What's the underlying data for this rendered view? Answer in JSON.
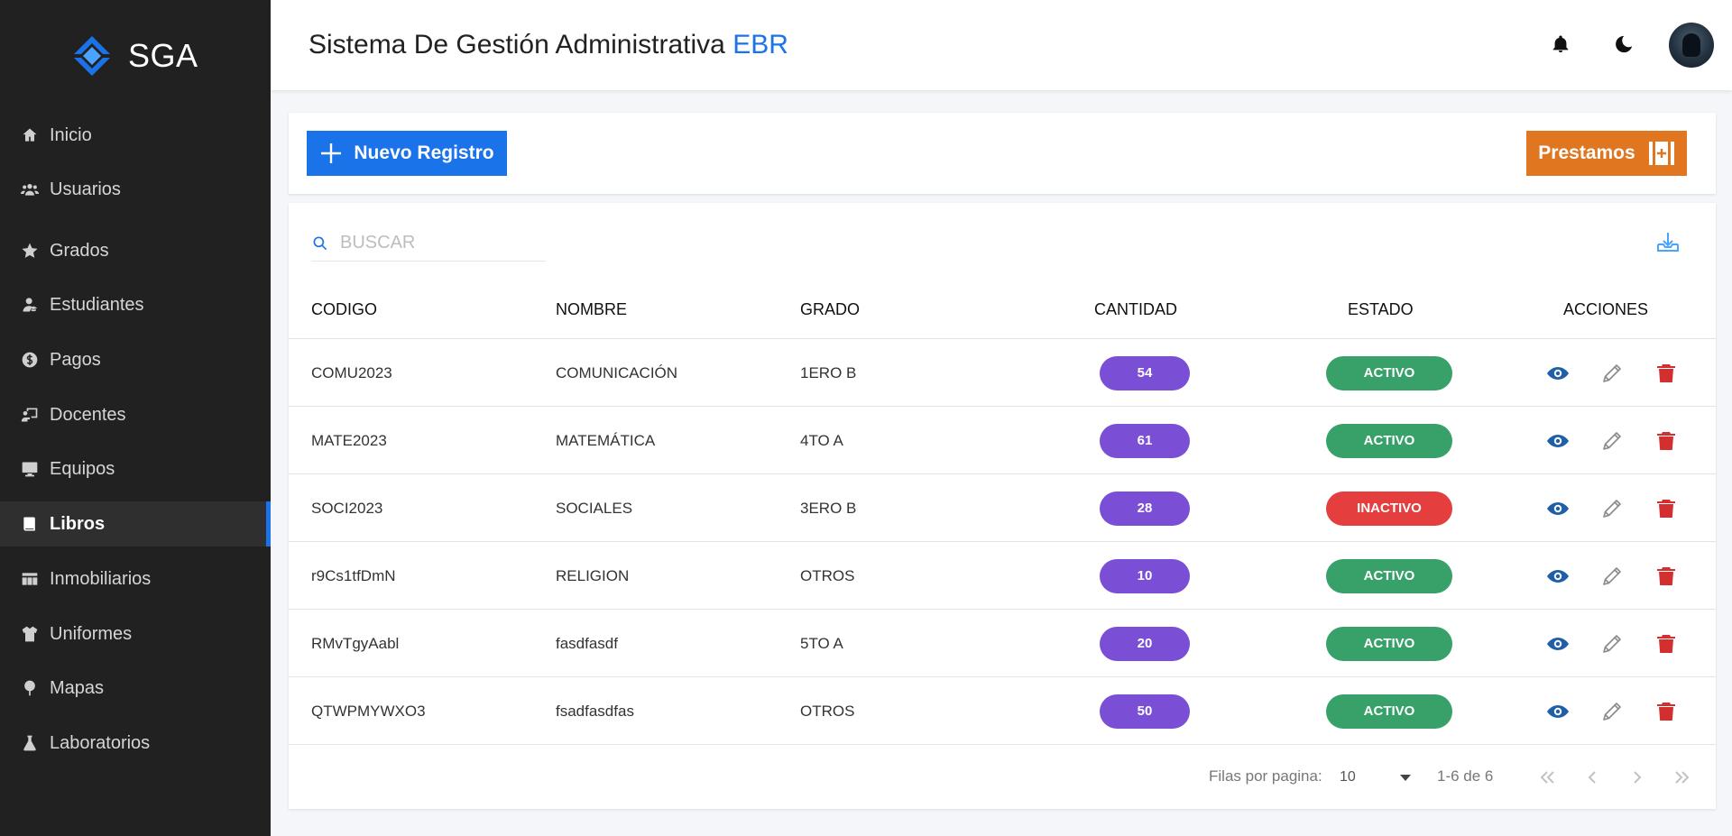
{
  "brand": {
    "name": "SGA",
    "accent": "#1a73e8"
  },
  "sidebar": {
    "items": [
      {
        "label": "Inicio",
        "icon": "home-icon"
      },
      {
        "label": "Usuarios",
        "icon": "users-icon"
      },
      {
        "label": "Grados",
        "icon": "star-icon"
      },
      {
        "label": "Estudiantes",
        "icon": "student-icon"
      },
      {
        "label": "Pagos",
        "icon": "dollar-icon"
      },
      {
        "label": "Docentes",
        "icon": "teacher-icon"
      },
      {
        "label": "Equipos",
        "icon": "monitor-icon"
      },
      {
        "label": "Libros",
        "icon": "book-icon",
        "active": true
      },
      {
        "label": "Inmobiliarios",
        "icon": "table-icon"
      },
      {
        "label": "Uniformes",
        "icon": "uniform-icon"
      },
      {
        "label": "Mapas",
        "icon": "map-pin-icon"
      },
      {
        "label": "Laboratorios",
        "icon": "flask-icon"
      }
    ]
  },
  "header": {
    "title": "Sistema De Gestión Administrativa",
    "title_accent": "EBR",
    "icons": [
      "bell-icon",
      "moon-icon",
      "avatar"
    ]
  },
  "actions": {
    "new_label": "Nuevo Registro",
    "loans_label": "Prestamos",
    "new_color": "#1a73e8",
    "loans_color": "#e07720"
  },
  "search": {
    "placeholder": "BUSCAR",
    "value": ""
  },
  "table": {
    "headers": {
      "code": "CODIGO",
      "name": "NOMBRE",
      "grade": "GRADO",
      "qty": "CANTIDAD",
      "status": "ESTADO",
      "actions": "ACCIONES"
    },
    "rows": [
      {
        "code": "COMU2023",
        "name": "COMUNICACIÓN",
        "grade": "1ERO B",
        "qty": "54",
        "status": "ACTIVO"
      },
      {
        "code": "MATE2023",
        "name": "MATEMÁTICA",
        "grade": "4TO A",
        "qty": "61",
        "status": "ACTIVO"
      },
      {
        "code": "SOCI2023",
        "name": "SOCIALES",
        "grade": "3ERO B",
        "qty": "28",
        "status": "INACTIVO"
      },
      {
        "code": "r9Cs1tfDmN",
        "name": "RELIGION",
        "grade": "OTROS",
        "qty": "10",
        "status": "ACTIVO"
      },
      {
        "code": "RMvTgyAabl",
        "name": "fasdfasdf",
        "grade": "5TO A",
        "qty": "20",
        "status": "ACTIVO"
      },
      {
        "code": "QTWPMYWXO3",
        "name": "fsadfasdfas",
        "grade": "OTROS",
        "qty": "50",
        "status": "ACTIVO"
      }
    ],
    "status_colors": {
      "ACTIVO": "#38a169",
      "INACTIVO": "#e53e3e"
    },
    "qty_color": "#7a4fd6"
  },
  "pagination": {
    "rows_label": "Filas por pagina:",
    "rows_value": "10",
    "range": "1-6 de 6"
  }
}
